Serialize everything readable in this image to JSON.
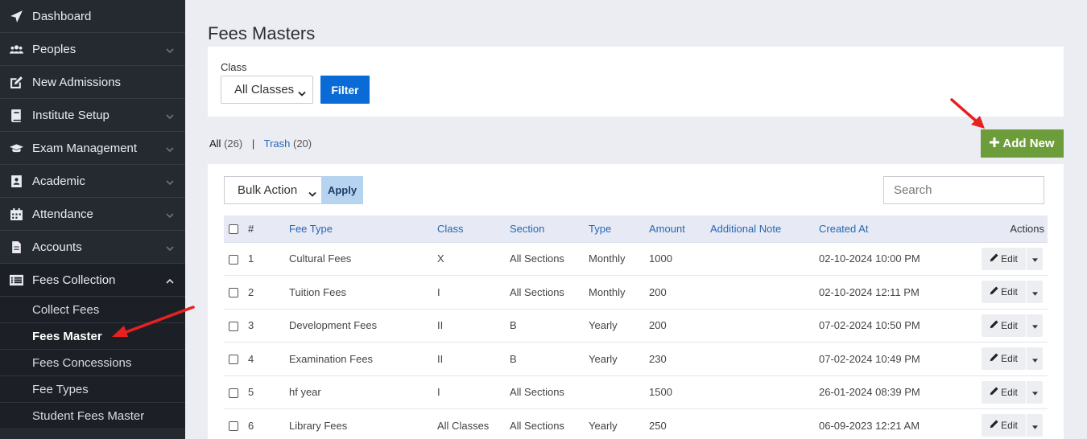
{
  "sidebar": {
    "items": [
      {
        "label": "Dashboard",
        "icon": "paper-plane-icon"
      },
      {
        "label": "Peoples",
        "icon": "users-icon"
      },
      {
        "label": "New Admissions",
        "icon": "edit-icon"
      },
      {
        "label": "Institute Setup",
        "icon": "book-icon"
      },
      {
        "label": "Exam Management",
        "icon": "graduation-cap-icon"
      },
      {
        "label": "Academic",
        "icon": "id-badge-icon"
      },
      {
        "label": "Attendance",
        "icon": "calendar-icon"
      },
      {
        "label": "Accounts",
        "icon": "file-icon"
      },
      {
        "label": "Fees Collection",
        "icon": "list-alt-icon"
      }
    ],
    "submenu": [
      {
        "label": "Collect Fees"
      },
      {
        "label": "Fees Master"
      },
      {
        "label": "Fees Concessions"
      },
      {
        "label": "Fee Types"
      },
      {
        "label": "Student Fees Master"
      }
    ]
  },
  "page": {
    "title": "Fees Masters",
    "filter": {
      "label": "Class",
      "selected": "All Classes",
      "button": "Filter"
    },
    "tabs": {
      "all_label": "All",
      "all_count": "(26)",
      "separator": "|",
      "trash_label": "Trash",
      "trash_count": "(20)"
    },
    "add_button": "Add New",
    "bulk": {
      "selected": "Bulk Action",
      "apply": "Apply"
    },
    "search_placeholder": "Search"
  },
  "table": {
    "headers": [
      "#",
      "Fee Type",
      "Class",
      "Section",
      "Type",
      "Amount",
      "Additional Note",
      "Created At",
      "Actions"
    ],
    "edit_label": "Edit",
    "rows": [
      {
        "num": "1",
        "fee_type": "Cultural Fees",
        "class": "X",
        "section": "All Sections",
        "type": "Monthly",
        "amount": "1000",
        "note": "",
        "created": "02-10-2024 10:00 PM"
      },
      {
        "num": "2",
        "fee_type": "Tuition Fees",
        "class": "I",
        "section": "All Sections",
        "type": "Monthly",
        "amount": "200",
        "note": "",
        "created": "02-10-2024 12:11 PM"
      },
      {
        "num": "3",
        "fee_type": "Development Fees",
        "class": "II",
        "section": "B",
        "type": "Yearly",
        "amount": "200",
        "note": "",
        "created": "07-02-2024 10:50 PM"
      },
      {
        "num": "4",
        "fee_type": "Examination Fees",
        "class": "II",
        "section": "B",
        "type": "Yearly",
        "amount": "230",
        "note": "",
        "created": "07-02-2024 10:49 PM"
      },
      {
        "num": "5",
        "fee_type": "hf year",
        "class": "I",
        "section": "All Sections",
        "type": "",
        "amount": "1500",
        "note": "",
        "created": "26-01-2024 08:39 PM"
      },
      {
        "num": "6",
        "fee_type": "Library Fees",
        "class": "All Classes",
        "section": "All Sections",
        "type": "Yearly",
        "amount": "250",
        "note": "",
        "created": "06-09-2023 12:21 AM"
      }
    ]
  },
  "colors": {
    "sidebar_bg": "#252a31",
    "primary": "#0b6bd6",
    "success": "#6d9c3a",
    "annotation_arrow": "#e8201f"
  }
}
